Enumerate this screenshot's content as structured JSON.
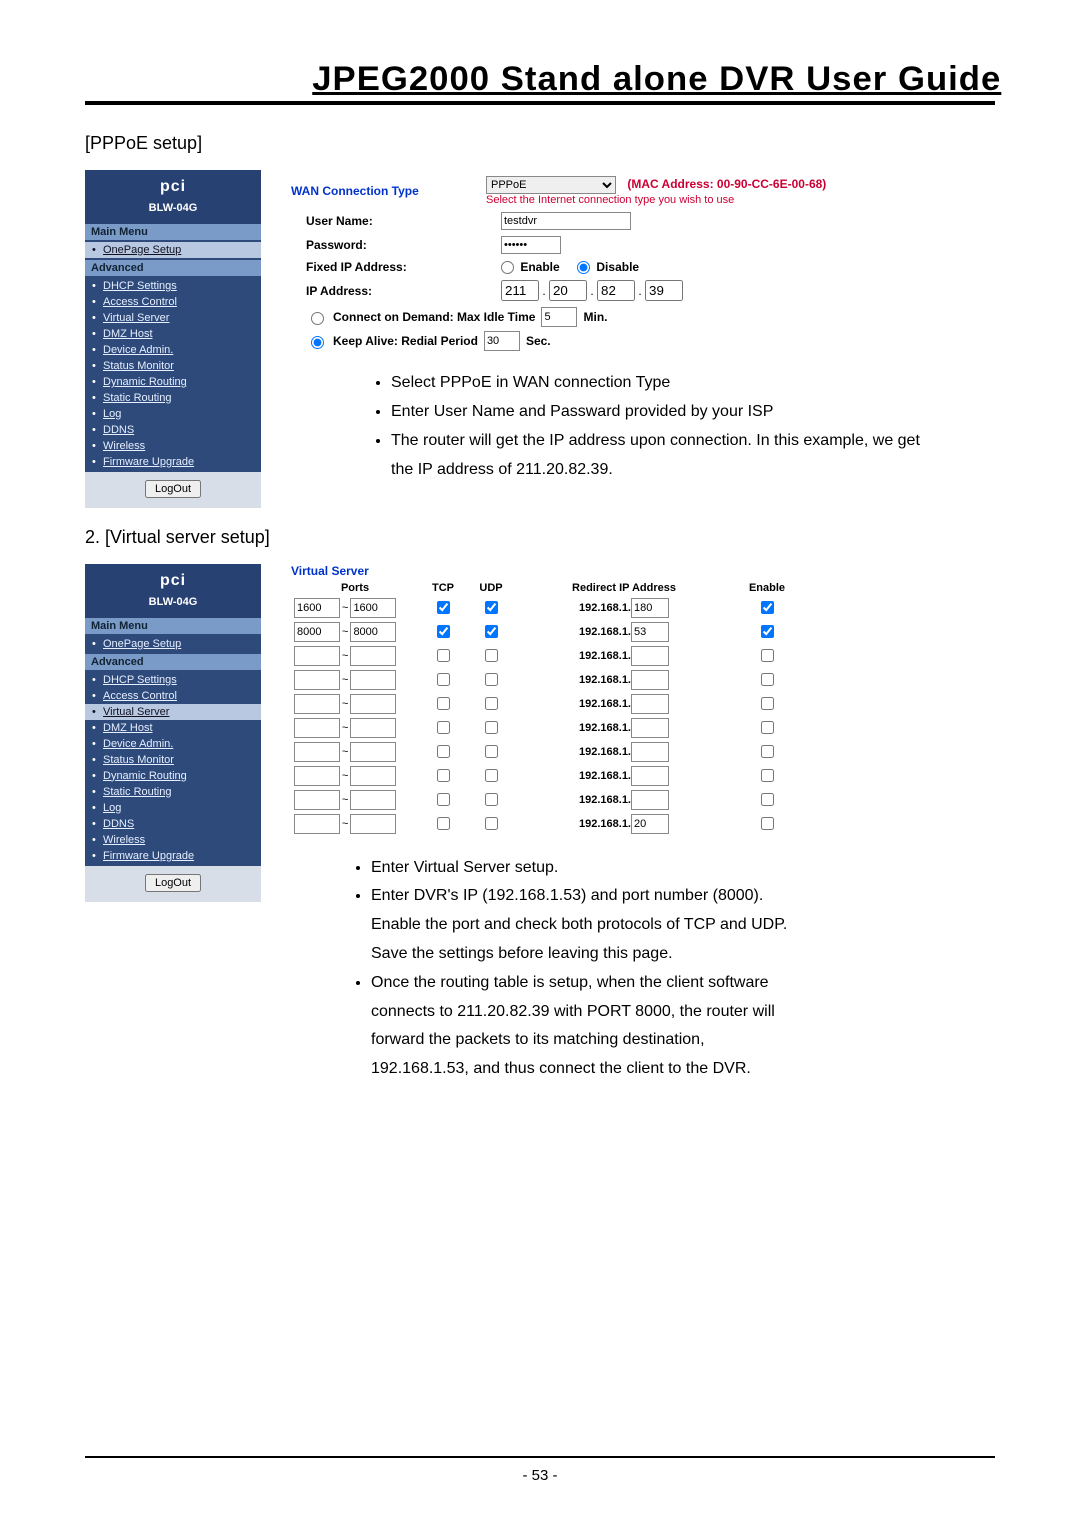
{
  "doc_title": "JPEG2000 Stand alone DVR User Guide",
  "page_number": "- 53 -",
  "section1": {
    "heading": "[PPPoE setup]",
    "instructions": [
      "Select PPPoE in WAN connection Type",
      "Enter User Name and Passward provided by your ISP",
      "The router will get the IP address upon connection. In this example, we get the IP address of 211.20.82.39."
    ]
  },
  "section2": {
    "heading": "2. [Virtual server setup]",
    "instructions": [
      "Enter Virtual Server setup.",
      "Enter DVR's IP (192.168.1.53) and port number (8000). Enable the port and check both protocols of TCP and UDP. Save the settings before leaving this page.",
      "Once the routing table is setup, when the client software connects to 211.20.82.39 with PORT 8000, the router will forward the packets to its matching destination, 192.168.1.53, and thus connect the client to the DVR."
    ]
  },
  "sidebar": {
    "brand": "pci",
    "model": "BLW-04G",
    "main_menu_label": "Main Menu",
    "advanced_label": "Advanced",
    "main_items": [
      "OnePage Setup"
    ],
    "advanced_items": [
      "DHCP Settings",
      "Access Control",
      "Virtual Server",
      "DMZ Host",
      "Device Admin.",
      "Status Monitor",
      "Dynamic Routing",
      "Static Routing",
      "Log",
      "DDNS",
      "Wireless",
      "Firmware Upgrade"
    ],
    "logout_label": "LogOut"
  },
  "active_menu_pppoe": "OnePage Setup",
  "active_menu_vs": "Virtual Server",
  "wan": {
    "title": "WAN Connection Type",
    "type_value": "PPPoE",
    "mac_label": "(MAC Address: 00-90-CC-6E-00-68)",
    "helper": "Select the Internet connection type you wish to use",
    "username_label": "User Name:",
    "username_value": "testdvr",
    "password_label": "Password:",
    "password_value": "******",
    "fixed_ip_label": "Fixed IP Address:",
    "enable_label": "Enable",
    "disable_label": "Disable",
    "ip_label": "IP Address:",
    "ip_octets": [
      "211",
      "20",
      "82",
      "39"
    ],
    "connect_on_demand_label": "Connect on Demand: Max Idle Time",
    "connect_on_demand_value": "5",
    "min_label": "Min.",
    "keep_alive_label": "Keep Alive: Redial Period",
    "keep_alive_value": "30",
    "sec_label": "Sec."
  },
  "vs": {
    "title": "Virtual Server",
    "headers": {
      "ports": "Ports",
      "tcp": "TCP",
      "udp": "UDP",
      "redirect": "Redirect IP Address",
      "enable": "Enable"
    },
    "redirect_prefix": "192.168.1.",
    "rows": [
      {
        "port_from": "1600",
        "port_to": "1600",
        "tcp": true,
        "udp": true,
        "ip_suffix": "180",
        "enable": true
      },
      {
        "port_from": "8000",
        "port_to": "8000",
        "tcp": true,
        "udp": true,
        "ip_suffix": "53",
        "enable": true
      },
      {
        "port_from": "",
        "port_to": "",
        "tcp": false,
        "udp": false,
        "ip_suffix": "",
        "enable": false
      },
      {
        "port_from": "",
        "port_to": "",
        "tcp": false,
        "udp": false,
        "ip_suffix": "",
        "enable": false
      },
      {
        "port_from": "",
        "port_to": "",
        "tcp": false,
        "udp": false,
        "ip_suffix": "",
        "enable": false
      },
      {
        "port_from": "",
        "port_to": "",
        "tcp": false,
        "udp": false,
        "ip_suffix": "",
        "enable": false
      },
      {
        "port_from": "",
        "port_to": "",
        "tcp": false,
        "udp": false,
        "ip_suffix": "",
        "enable": false
      },
      {
        "port_from": "",
        "port_to": "",
        "tcp": false,
        "udp": false,
        "ip_suffix": "",
        "enable": false
      },
      {
        "port_from": "",
        "port_to": "",
        "tcp": false,
        "udp": false,
        "ip_suffix": "",
        "enable": false
      },
      {
        "port_from": "",
        "port_to": "",
        "tcp": false,
        "udp": false,
        "ip_suffix": "20",
        "enable": false
      }
    ]
  }
}
